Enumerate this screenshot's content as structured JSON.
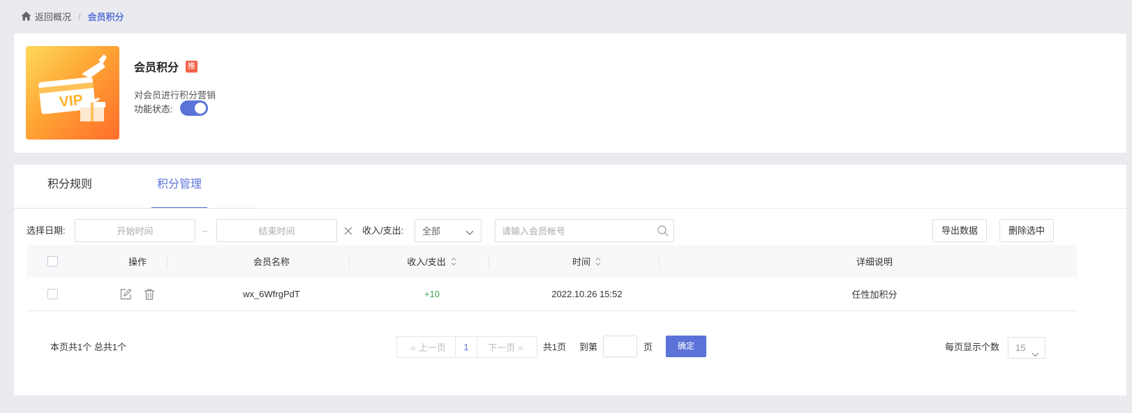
{
  "breadcrumb": {
    "back": "返回概况",
    "separator": "/",
    "current": "会员积分"
  },
  "plugin": {
    "title": "会员积分",
    "badge": "推",
    "description": "对会员进行积分营销",
    "status_label": "功能状态:",
    "enabled": true,
    "thumb_text": "VIP"
  },
  "tabs": [
    {
      "label": "积分规则",
      "active": false
    },
    {
      "label": "积分管理",
      "active": true
    }
  ],
  "filters": {
    "date_label": "选择日期:",
    "start_placeholder": "开始时间",
    "end_placeholder": "结束时间",
    "date_separator": "–",
    "io_label": "收入/支出:",
    "io_value": "全部",
    "search_placeholder": "请输入会员帐号",
    "export_button": "导出数据",
    "delete_button": "删除选中"
  },
  "table": {
    "headers": {
      "op": "操作",
      "name": "会员名称",
      "io": "收入/支出",
      "time": "时间",
      "desc": "详细说明"
    },
    "rows": [
      {
        "name": "wx_6WfrgPdT",
        "io": "+10",
        "time": "2022.10.26 15:52",
        "desc": "任性加积分"
      }
    ]
  },
  "pagination": {
    "summary": "本页共1个  总共1个",
    "prev": "上一页",
    "current_page": "1",
    "next": "下一页",
    "total_pages": "共1页",
    "goto_label": "到第",
    "page_unit": "页",
    "confirm": "确定",
    "per_page_label": "每页显示个数",
    "per_page_value": "15"
  },
  "colors": {
    "accent": "#5b73d8",
    "badge": "#f2634a",
    "income": "#3ba84a",
    "background": "#e9ebef"
  }
}
